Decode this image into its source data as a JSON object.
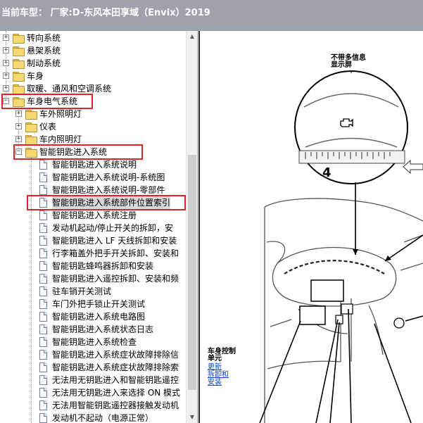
{
  "window": {
    "title": "当前车型： 厂家:D-东风本田享域（Envix）2019"
  },
  "tree": {
    "items": [
      {
        "label": "转向系统",
        "type": "folder",
        "expander": "+"
      },
      {
        "label": "悬架系统",
        "type": "folder",
        "expander": "+"
      },
      {
        "label": "制动系统",
        "type": "folder",
        "expander": "+"
      },
      {
        "label": "车身",
        "type": "folder",
        "expander": "+"
      },
      {
        "label": "取暖、通风和空调系统",
        "type": "folder",
        "expander": "+"
      },
      {
        "label": "车身电气系统",
        "type": "folder",
        "expander": "−",
        "highlighted": true
      },
      {
        "label": "车外照明灯",
        "type": "folder",
        "expander": "+"
      },
      {
        "label": "仪表",
        "type": "folder",
        "expander": "+"
      },
      {
        "label": "车内照明灯",
        "type": "folder",
        "expander": "+"
      },
      {
        "label": "智能钥匙进入系统",
        "type": "folder",
        "expander": "−",
        "highlighted": true
      },
      {
        "label": "智能钥匙进入系统说明",
        "type": "doc"
      },
      {
        "label": "智能钥匙进入系统说明-系统图",
        "type": "doc"
      },
      {
        "label": "智能钥匙进入系统说明-零部件",
        "type": "doc"
      },
      {
        "label": "智能钥匙进入系统部件位置索引",
        "type": "doc",
        "selected": true,
        "highlighted": true
      },
      {
        "label": "智能钥匙进入系统注册",
        "type": "doc"
      },
      {
        "label": "发动机起动/停止开关的拆卸，安",
        "type": "doc"
      },
      {
        "label": "智能钥匙进入 LF 天线拆卸和安装",
        "type": "doc"
      },
      {
        "label": "行李箱盖外把手开关拆卸、安装和",
        "type": "doc"
      },
      {
        "label": "智能钥匙蜂鸣器拆卸和安装",
        "type": "doc"
      },
      {
        "label": "智能钥匙进入遥控拆卸、安装和频",
        "type": "doc"
      },
      {
        "label": "驻车销开关测试",
        "type": "doc"
      },
      {
        "label": "车门外把手锁止开关测试",
        "type": "doc"
      },
      {
        "label": "智能钥匙进入系统电路图",
        "type": "doc"
      },
      {
        "label": "智能钥匙进入系统状态日志",
        "type": "doc"
      },
      {
        "label": "智能钥匙进入系统检查",
        "type": "doc"
      },
      {
        "label": "智能钥匙进入系统症状故障排除信",
        "type": "doc"
      },
      {
        "label": "智能钥匙进入系统症状故障排除索",
        "type": "doc"
      },
      {
        "label": "无法用无钥匙进入和智能钥匙遥控",
        "type": "doc"
      },
      {
        "label": "无法用无钥匙进入来选择 ON 模式",
        "type": "doc"
      },
      {
        "label": "无法用智能钥匙遥控器接触发动机",
        "type": "doc"
      },
      {
        "label": "发动机不起动（电源正常）",
        "type": "doc"
      }
    ]
  },
  "figure": {
    "display_label_line1": "不带多信息",
    "display_label_line2": "显示屏",
    "gauge_number": "4",
    "body_control_line1": "车身控制",
    "body_control_line2": "单元",
    "link_update": "更新",
    "link_remove": "拆卸和",
    "link_install": "安装"
  },
  "colors": {
    "highlight_box": "#d8262b",
    "titlebar_bg": "#9ea3ab",
    "link": "#0b3fd6"
  }
}
